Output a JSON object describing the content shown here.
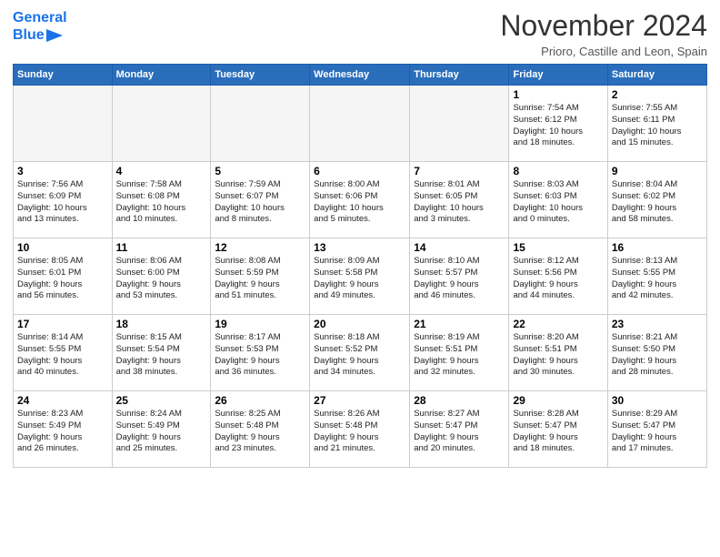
{
  "header": {
    "logo_line1": "General",
    "logo_line2": "Blue",
    "month_title": "November 2024",
    "location": "Prioro, Castille and Leon, Spain"
  },
  "weekdays": [
    "Sunday",
    "Monday",
    "Tuesday",
    "Wednesday",
    "Thursday",
    "Friday",
    "Saturday"
  ],
  "weeks": [
    [
      {
        "day": "",
        "text": ""
      },
      {
        "day": "",
        "text": ""
      },
      {
        "day": "",
        "text": ""
      },
      {
        "day": "",
        "text": ""
      },
      {
        "day": "",
        "text": ""
      },
      {
        "day": "1",
        "text": "Sunrise: 7:54 AM\nSunset: 6:12 PM\nDaylight: 10 hours\nand 18 minutes."
      },
      {
        "day": "2",
        "text": "Sunrise: 7:55 AM\nSunset: 6:11 PM\nDaylight: 10 hours\nand 15 minutes."
      }
    ],
    [
      {
        "day": "3",
        "text": "Sunrise: 7:56 AM\nSunset: 6:09 PM\nDaylight: 10 hours\nand 13 minutes."
      },
      {
        "day": "4",
        "text": "Sunrise: 7:58 AM\nSunset: 6:08 PM\nDaylight: 10 hours\nand 10 minutes."
      },
      {
        "day": "5",
        "text": "Sunrise: 7:59 AM\nSunset: 6:07 PM\nDaylight: 10 hours\nand 8 minutes."
      },
      {
        "day": "6",
        "text": "Sunrise: 8:00 AM\nSunset: 6:06 PM\nDaylight: 10 hours\nand 5 minutes."
      },
      {
        "day": "7",
        "text": "Sunrise: 8:01 AM\nSunset: 6:05 PM\nDaylight: 10 hours\nand 3 minutes."
      },
      {
        "day": "8",
        "text": "Sunrise: 8:03 AM\nSunset: 6:03 PM\nDaylight: 10 hours\nand 0 minutes."
      },
      {
        "day": "9",
        "text": "Sunrise: 8:04 AM\nSunset: 6:02 PM\nDaylight: 9 hours\nand 58 minutes."
      }
    ],
    [
      {
        "day": "10",
        "text": "Sunrise: 8:05 AM\nSunset: 6:01 PM\nDaylight: 9 hours\nand 56 minutes."
      },
      {
        "day": "11",
        "text": "Sunrise: 8:06 AM\nSunset: 6:00 PM\nDaylight: 9 hours\nand 53 minutes."
      },
      {
        "day": "12",
        "text": "Sunrise: 8:08 AM\nSunset: 5:59 PM\nDaylight: 9 hours\nand 51 minutes."
      },
      {
        "day": "13",
        "text": "Sunrise: 8:09 AM\nSunset: 5:58 PM\nDaylight: 9 hours\nand 49 minutes."
      },
      {
        "day": "14",
        "text": "Sunrise: 8:10 AM\nSunset: 5:57 PM\nDaylight: 9 hours\nand 46 minutes."
      },
      {
        "day": "15",
        "text": "Sunrise: 8:12 AM\nSunset: 5:56 PM\nDaylight: 9 hours\nand 44 minutes."
      },
      {
        "day": "16",
        "text": "Sunrise: 8:13 AM\nSunset: 5:55 PM\nDaylight: 9 hours\nand 42 minutes."
      }
    ],
    [
      {
        "day": "17",
        "text": "Sunrise: 8:14 AM\nSunset: 5:55 PM\nDaylight: 9 hours\nand 40 minutes."
      },
      {
        "day": "18",
        "text": "Sunrise: 8:15 AM\nSunset: 5:54 PM\nDaylight: 9 hours\nand 38 minutes."
      },
      {
        "day": "19",
        "text": "Sunrise: 8:17 AM\nSunset: 5:53 PM\nDaylight: 9 hours\nand 36 minutes."
      },
      {
        "day": "20",
        "text": "Sunrise: 8:18 AM\nSunset: 5:52 PM\nDaylight: 9 hours\nand 34 minutes."
      },
      {
        "day": "21",
        "text": "Sunrise: 8:19 AM\nSunset: 5:51 PM\nDaylight: 9 hours\nand 32 minutes."
      },
      {
        "day": "22",
        "text": "Sunrise: 8:20 AM\nSunset: 5:51 PM\nDaylight: 9 hours\nand 30 minutes."
      },
      {
        "day": "23",
        "text": "Sunrise: 8:21 AM\nSunset: 5:50 PM\nDaylight: 9 hours\nand 28 minutes."
      }
    ],
    [
      {
        "day": "24",
        "text": "Sunrise: 8:23 AM\nSunset: 5:49 PM\nDaylight: 9 hours\nand 26 minutes."
      },
      {
        "day": "25",
        "text": "Sunrise: 8:24 AM\nSunset: 5:49 PM\nDaylight: 9 hours\nand 25 minutes."
      },
      {
        "day": "26",
        "text": "Sunrise: 8:25 AM\nSunset: 5:48 PM\nDaylight: 9 hours\nand 23 minutes."
      },
      {
        "day": "27",
        "text": "Sunrise: 8:26 AM\nSunset: 5:48 PM\nDaylight: 9 hours\nand 21 minutes."
      },
      {
        "day": "28",
        "text": "Sunrise: 8:27 AM\nSunset: 5:47 PM\nDaylight: 9 hours\nand 20 minutes."
      },
      {
        "day": "29",
        "text": "Sunrise: 8:28 AM\nSunset: 5:47 PM\nDaylight: 9 hours\nand 18 minutes."
      },
      {
        "day": "30",
        "text": "Sunrise: 8:29 AM\nSunset: 5:47 PM\nDaylight: 9 hours\nand 17 minutes."
      }
    ]
  ]
}
